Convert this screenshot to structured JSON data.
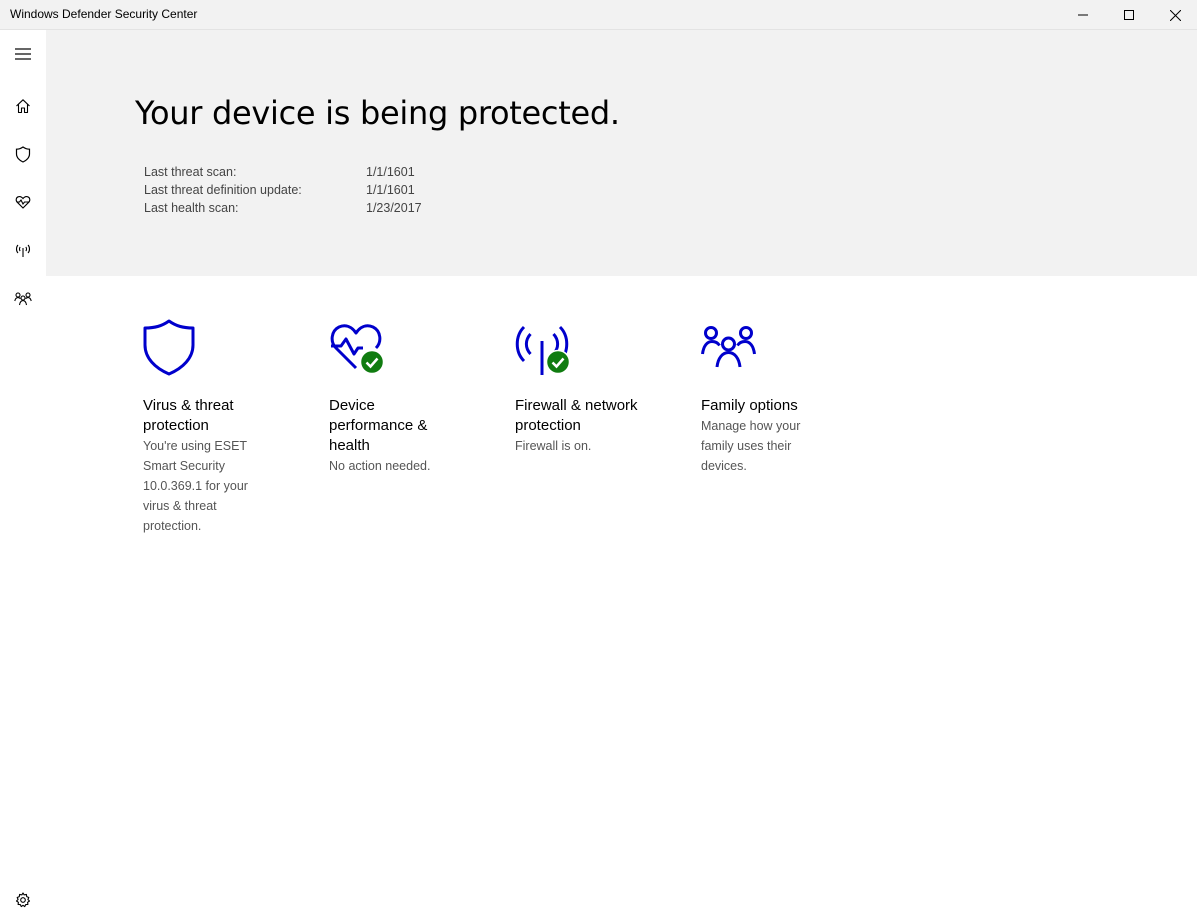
{
  "window": {
    "title": "Windows Defender Security Center"
  },
  "sidebar": {
    "items": [
      {
        "icon": "hamburger-menu-icon"
      },
      {
        "icon": "home-icon"
      },
      {
        "icon": "shield-icon"
      },
      {
        "icon": "heart-health-icon"
      },
      {
        "icon": "antenna-network-icon"
      },
      {
        "icon": "family-icon"
      },
      {
        "icon": "gear-icon"
      }
    ]
  },
  "hero": {
    "heading": "Your device is being protected.",
    "scans": [
      {
        "label": "Last threat scan:",
        "value": "1/1/1601"
      },
      {
        "label": "Last threat definition update:",
        "value": "1/1/1601"
      },
      {
        "label": "Last health scan:",
        "value": "1/23/2017"
      }
    ]
  },
  "tiles": [
    {
      "title": "Virus & threat protection",
      "description": "You're using ESET Smart Security 10.0.369.1 for your virus & threat protection.",
      "icon": "shield-icon"
    },
    {
      "title": "Device performance & health",
      "description": "No action needed.",
      "icon": "heart-health-icon"
    },
    {
      "title": "Firewall & network protection",
      "description": "Firewall is on.",
      "icon": "antenna-network-icon"
    },
    {
      "title": "Family options",
      "description": "Manage how your family uses their devices.",
      "icon": "family-icon"
    }
  ],
  "colors": {
    "accent": "#0000cc",
    "ok_green": "#107c10",
    "hero_bg": "#f2f2f2"
  }
}
